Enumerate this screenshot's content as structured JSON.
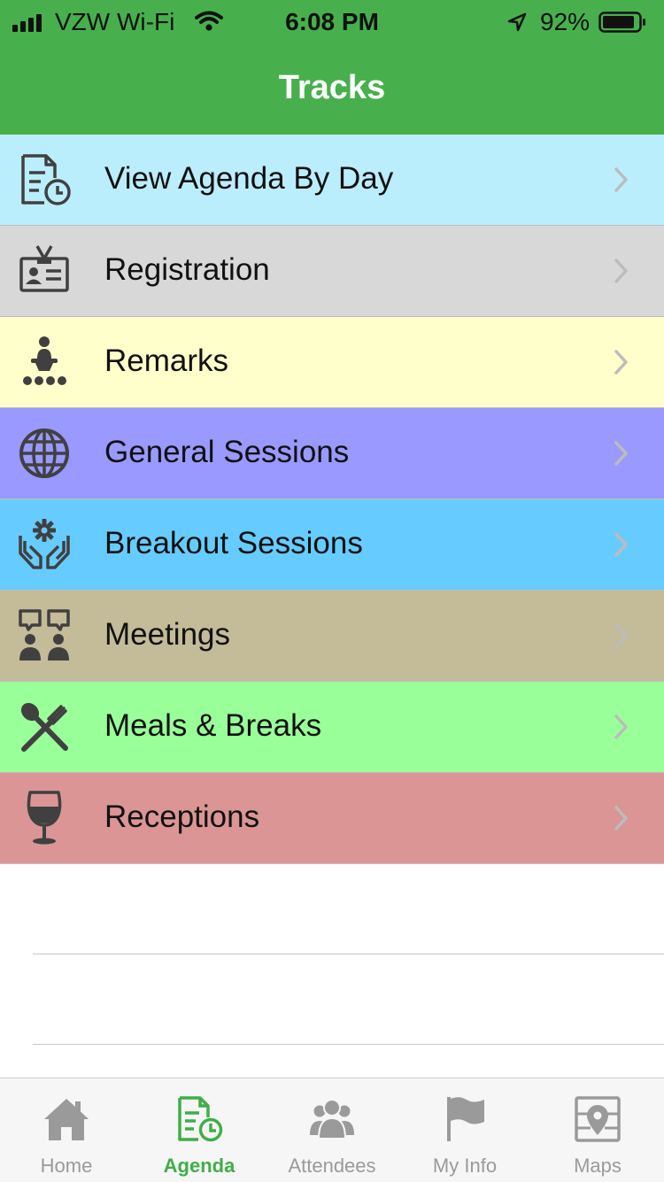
{
  "status_bar": {
    "carrier": "VZW Wi-Fi",
    "time": "6:08 PM",
    "battery": "92%",
    "battery_level": 0.92,
    "icons": [
      "signal-icon",
      "wifi-icon",
      "location-arrow-icon",
      "battery-icon"
    ]
  },
  "header": {
    "title": "Tracks",
    "color": "#47b04d"
  },
  "tracks": [
    {
      "label": "View Agenda By Day",
      "icon": "agenda-clock-icon",
      "color": "#bbeefc"
    },
    {
      "label": "Registration",
      "icon": "id-badge-icon",
      "color": "#d8d8d8"
    },
    {
      "label": "Remarks",
      "icon": "speaker-podium-icon",
      "color": "#ffffcc"
    },
    {
      "label": "General Sessions",
      "icon": "globe-icon",
      "color": "#9999ff"
    },
    {
      "label": "Breakout Sessions",
      "icon": "hands-gear-icon",
      "color": "#66ccff"
    },
    {
      "label": "Meetings",
      "icon": "meeting-people-icon",
      "color": "#c4bb98"
    },
    {
      "label": "Meals & Breaks",
      "icon": "utensils-icon",
      "color": "#99ff99"
    },
    {
      "label": "Receptions",
      "icon": "wine-glass-icon",
      "color": "#db9595"
    }
  ],
  "tabbar": {
    "active_color": "#3fae49",
    "inactive_color": "#9a9a9a",
    "tabs": [
      {
        "label": "Home",
        "icon": "home-icon",
        "active": false
      },
      {
        "label": "Agenda",
        "icon": "agenda-clock-icon",
        "active": true
      },
      {
        "label": "Attendees",
        "icon": "people-icon",
        "active": false
      },
      {
        "label": "My Info",
        "icon": "flag-icon",
        "active": false
      },
      {
        "label": "Maps",
        "icon": "map-pin-icon",
        "active": false
      }
    ]
  }
}
